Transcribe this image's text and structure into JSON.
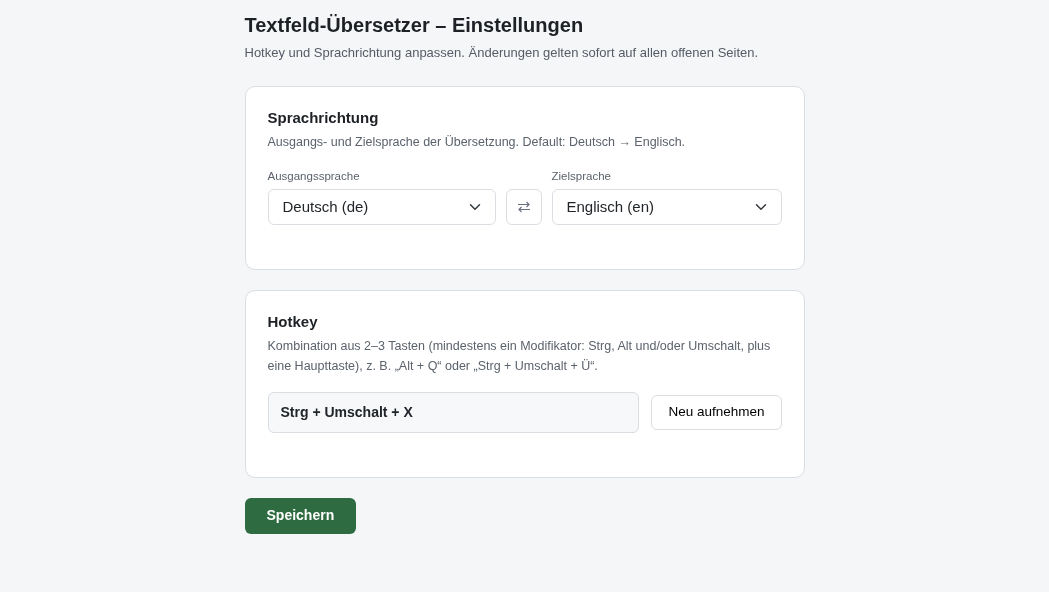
{
  "header": {
    "title": "Textfeld-Übersetzer – Einstellungen",
    "subtitle": "Hotkey und Sprachrichtung anpassen. Änderungen gelten sofort auf allen offenen Seiten."
  },
  "language_card": {
    "title": "Sprachrichtung",
    "description": "Ausgangs- und Zielsprache der Übersetzung. Default: Deutsch → Englisch.",
    "source": {
      "label": "Ausgangssprache",
      "value": "Deutsch (de)"
    },
    "target": {
      "label": "Zielsprache",
      "value": "Englisch (en)"
    }
  },
  "hotkey_card": {
    "title": "Hotkey",
    "description": "Kombination aus 2–3 Tasten (mindestens ein Modifikator: Strg, Alt und/oder Umschalt, plus eine Haupttaste), z. B. „Alt + Q“ oder „Strg + Umschalt + Ü“.",
    "value": "Strg + Umschalt + X",
    "record_button": "Neu aufnehmen"
  },
  "save_button": "Speichern"
}
